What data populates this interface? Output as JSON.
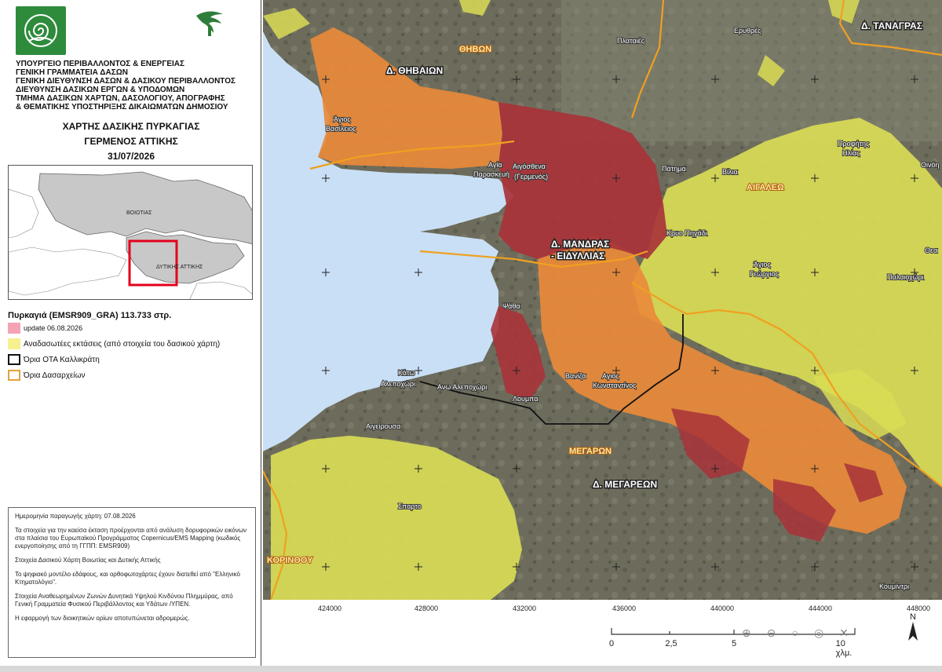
{
  "header": {
    "ministry_lines": [
      "ΥΠΟΥΡΓΕΙΟ ΠΕΡΙΒΑΛΛΟΝΤΟΣ & ΕΝΕΡΓΕΙΑΣ",
      "ΓΕΝΙΚΗ ΓΡΑΜΜΑΤΕΙΑ ΔΑΣΩΝ",
      "ΓΕΝΙΚΗ ΔΙΕΥΘΥΝΣΗ ΔΑΣΩΝ & ΔΑΣΙΚΟΥ ΠΕΡΙΒΑΛΛΟΝΤΟΣ",
      "ΔΙΕΥΘΥΝΣΗ ΔΑΣΙΚΩΝ ΕΡΓΩΝ & ΥΠΟΔΟΜΩΝ",
      "ΤΜΗΜΑ ΔΑΣΙΚΩΝ ΧΑΡΤΩΝ, ΔΑΣΟΛΟΓΙΟΥ, ΑΠΟΓΡΑΦΗΣ",
      "& ΘΕΜΑΤΙΚΗΣ ΥΠΟΣΤΗΡΙΞΗΣ ΔΙΚΑΙΩΜΑΤΩΝ ΔΗΜΟΣΙΟΥ"
    ],
    "title_line1": "ΧΑΡΤΗΣ ΔΑΣΙΚΗΣ ΠΥΡΚΑΓΙΑΣ",
    "title_line2": "ΓΕΡΜΕΝΟΣ ΑΤΤΙΚΗΣ",
    "title_date": "31/07/2026"
  },
  "inset": {
    "label_voiotia": "ΒΟΙΩΤΙΑΣ",
    "label_attiki": "ΔΥΤΙΚΗΣ ΑΤΤΙΚΗΣ"
  },
  "legend": {
    "title": "Πυρκαγιά (EMSR909_GRA)  113.733 στρ.",
    "fire_update": "update 06.08.2026",
    "reforest": "Αναδασωτέες εκτάσεις (από στοιχεία του δασικού χάρτη)",
    "ota": "Όρια ΟΤΑ Καλλικράτη",
    "dasarxeia": "Όρια Δασαρχείων"
  },
  "notes": [
    "Ημερομηνία παραγωγής χάρτη: 07.08.2026",
    "Τα στοιχεία για την καείσα έκταση προέρχονται από ανάλυση δορυφορικών εικόνων στα πλαίσια του Ευρωπαϊκού Προγράμματος Copernicus/EMS Mapping (κωδικός ενεργοποίησης από τη ΓΓΠΠ: EMSR909)",
    "Στοιχεία Δασικού Χάρτη Βοιωτίας και Δυτικής Αττικής",
    "Το ψηφιακό μοντέλο εδάφους, και ορθοφωτοχάρτες έχουν διατεθεί από \"Ελληνικό Κτηματολόγιο\".",
    "Στοιχεία Αναθεωρημένων Ζωνών Δυνητικά Υψηλού Κινδύνου Πλημμύρας, από Γενική Γραμματεία Φυσικού Περιβάλλοντος και Υδάτων /ΥΠΕΝ.",
    "Η εφαρμογή των διοικητικών ορίων αποτυπώνεται αδρομερώς."
  ],
  "map": {
    "district_labels": {
      "thiveon": "Δ. ΘΗΒΑΙΩΝ",
      "tanagras": "Δ. ΤΑΝΑΓΡΑΣ",
      "mandras_1": "Δ. ΜΑΝΔΡΑΣ",
      "mandras_2": "- ΕΙΔΥΛΛΙΑΣ",
      "megareon": "Δ. ΜΕΓΑΡΕΩΝ"
    },
    "forestry_labels": {
      "thivon": "ΘΗΒΩΝ",
      "aigaleo": "ΑΙΓΑΛΕΩ",
      "megaron": "ΜΕΓΑΡΩΝ",
      "korinthou": "ΚΟΡΙΝΘΟΥ"
    },
    "places": {
      "plataies": "Πλαταιές",
      "erythres": "Ερυθρές",
      "agios_vasileios_1": "Άγιος",
      "agios_vasileios_2": "Βασίλειος",
      "agia_paraskevi_1": "Αγία",
      "agia_paraskevi_2": "Παρασκευή",
      "aigosthena_1": "Αιγόσθενα",
      "aigosthena_2": "(Γερμενός)",
      "patima": "Πάτημα",
      "vilia": "Βίλια",
      "profitis_ilias_1": "Προφήτης",
      "profitis_ilias_2": "Ηλίας",
      "oinoi": "Οινόη",
      "kryo_pigadi": "Κρυο Πηγάδι",
      "agios_georgios_1": "Άγιος",
      "agios_georgios_2": "Γεώργιος",
      "paliochori": "Παλαιοχώρι",
      "thea": "Θεα",
      "psatha": "Ψάθα",
      "kato_alepochori_1": "Κάτω",
      "kato_alepochori_2": "Αλεποχώρι",
      "ano_alepochori": "Ανω Αλεποχώρι",
      "vaniza": "Βανίζα",
      "agios_konstantinos_1": "Αγιος",
      "agios_konstantinos_2": "Κωνσταντίνος",
      "loumpa": "Λουμπα",
      "aigeirousa": "Αιγείρουσα",
      "sparto": "Σπαρτο",
      "koumintri": "Κουμίντρι"
    },
    "x_ticks": [
      "424000",
      "428000",
      "432000",
      "436000",
      "440000",
      "444000",
      "448000"
    ]
  },
  "scale": {
    "labels": [
      "0",
      "2,5",
      "5",
      "10 χλμ."
    ]
  },
  "north": "N",
  "colors": {
    "fire_update": "#f4a3b4",
    "burned_dark": "#a8333a",
    "burned_orange": "#e98a3a",
    "reforest_yellow": "#d9dc55",
    "water": "#c9dff5",
    "terrain": "#6f6f5e",
    "dasarxeia_border": "#f0a020",
    "ota_border": "#111111"
  }
}
